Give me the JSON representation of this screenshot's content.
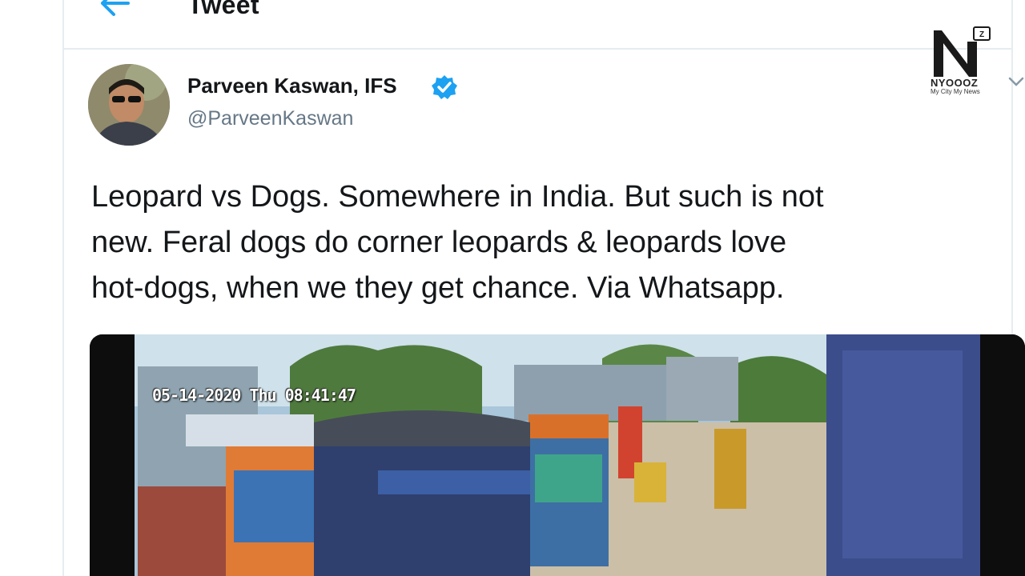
{
  "header": {
    "title": "Tweet",
    "back_icon": "arrow-left-icon"
  },
  "author": {
    "name": "Parveen Kaswan, IFS",
    "handle": "@ParveenKaswan",
    "verified": true
  },
  "tweet": {
    "lines": [
      "Leopard vs Dogs. Somewhere in India. But such is not",
      "new. Feral dogs do corner leopards & leopards love",
      "hot-dogs, when we they get chance. Via Whatsapp."
    ]
  },
  "media": {
    "timestamp": "05-14-2020 Thu 08:41:47"
  },
  "watermark": {
    "name": "NYOOOZ",
    "tagline": "My City My News"
  },
  "colors": {
    "accent": "#1da1f2",
    "text": "#14171a",
    "muted": "#657786",
    "border": "#e6ecf0"
  }
}
